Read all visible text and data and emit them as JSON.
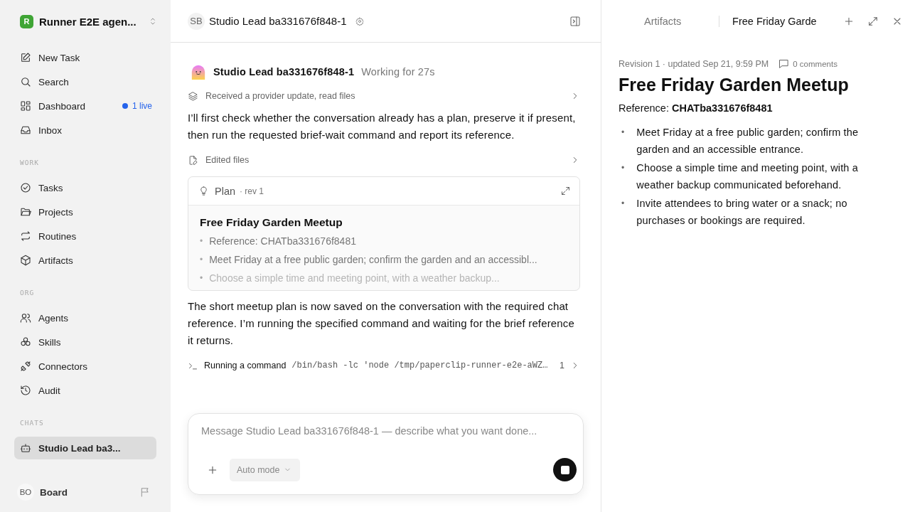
{
  "workspace": {
    "initial": "R",
    "name": "Runner E2E agen..."
  },
  "nav": [
    {
      "label": "New Task"
    },
    {
      "label": "Search"
    },
    {
      "label": "Dashboard",
      "badge": "1 live"
    },
    {
      "label": "Inbox"
    }
  ],
  "sections": [
    {
      "title": "WORK",
      "items": [
        {
          "label": "Tasks",
          "selected": false
        },
        {
          "label": "Projects",
          "selected": false
        },
        {
          "label": "Routines",
          "selected": false
        },
        {
          "label": "Artifacts",
          "selected": false
        }
      ]
    },
    {
      "title": "ORG",
      "items": [
        {
          "label": "Agents",
          "selected": false
        },
        {
          "label": "Skills",
          "selected": false
        },
        {
          "label": "Connectors",
          "selected": false
        },
        {
          "label": "Audit",
          "selected": false
        }
      ]
    },
    {
      "title": "CHATS",
      "items": [
        {
          "label": "Studio Lead ba3...",
          "selected": true
        }
      ]
    }
  ],
  "user": {
    "initials": "BO",
    "name": "Board"
  },
  "chat_header": {
    "initials": "SB",
    "title": "Studio Lead ba331676f848-1"
  },
  "message": {
    "author": "Studio Lead ba331676f848-1",
    "status": "Working for 27s",
    "blocks": [
      {
        "kind": "activity",
        "text": "Received a provider update, read files"
      },
      {
        "kind": "text",
        "text": "I’ll first check whether the conversation already has a plan, preserve it if present, then run the requested brief-wait command and report its reference."
      },
      {
        "kind": "activity",
        "text": "Edited files"
      },
      {
        "kind": "plan",
        "label": "Plan",
        "rev": "· rev 1",
        "title": "Free Friday Garden Meetup",
        "items": [
          {
            "bullet": "•",
            "text": "Reference: CHATba331676f8481",
            "faded": false
          },
          {
            "bullet": "•",
            "text": "Meet Friday at a free public garden; confirm the garden and an accessibl...",
            "faded": false
          },
          {
            "bullet": "•",
            "text": "Choose a simple time and meeting point, with a weather backup...",
            "faded": true
          }
        ]
      },
      {
        "kind": "text",
        "text": "The short meetup plan is now saved on the conversation with the required chat reference. I’m running the specified command and waiting for the brief reference it returns."
      },
      {
        "kind": "command",
        "label": "Running a command",
        "command": "/bin/bash -lc 'node /tmp/paperclip-runner-e2e-aWZ…",
        "count": "1"
      }
    ]
  },
  "composer": {
    "placeholder": "Message Studio Lead ba331676f848-1 — describe what you want done...",
    "mode": "Auto mode"
  },
  "panel": {
    "tabs": [
      {
        "label": "Artifacts",
        "selected": false
      },
      {
        "label": "Free Friday Garde",
        "selected": true
      }
    ],
    "meta": "Revision 1 · updated Sep 21, 9:59 PM",
    "comments": "0 comments",
    "title": "Free Friday Garden Meetup",
    "reference": "Reference: **CHATba331676f8481**",
    "bullets": [
      {
        "bullet": "•",
        "text": "Meet Friday at a free public garden; confirm the garden and an accessible entrance."
      },
      {
        "bullet": "•",
        "text": "Choose a simple time and meeting point, with a weather backup communicated beforehand."
      },
      {
        "bullet": "•",
        "text": "Invite attendees to bring water or a snack; no purchases or bookings are required."
      }
    ]
  }
}
